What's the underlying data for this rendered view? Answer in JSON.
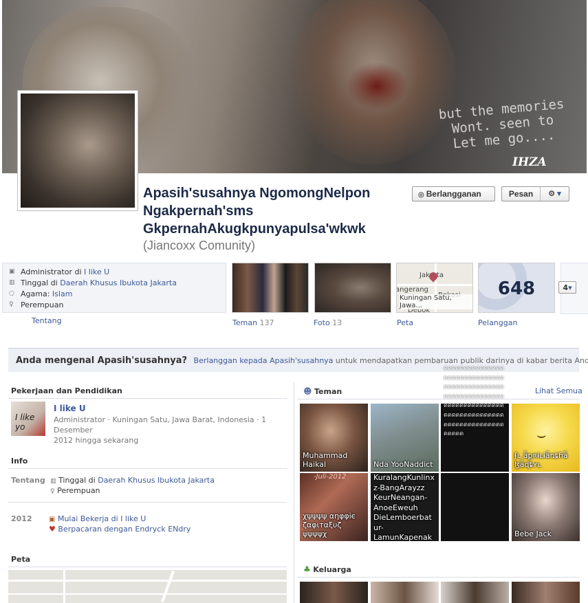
{
  "cover": {
    "quote_lines": [
      "but the memories",
      "Wont. seen to",
      "Let me go...."
    ],
    "signature": "IHZA"
  },
  "profile": {
    "name_lines": [
      "Apasih'susahnya NgomongNelpon",
      "Ngakpernah'sms",
      "GkpernahAkugkpunyapulsa'wkwk"
    ],
    "alternate_name": "(Jiancoxx Comunity)"
  },
  "actions": {
    "subscribe_label": "Berlangganan",
    "message_label": "Pesan"
  },
  "about": {
    "admin_prefix": "Administrator di ",
    "admin_link": "I like U",
    "lives_prefix": "Tinggal di ",
    "lives_link": "Daerah Khusus Ibukota Jakarta",
    "religion_prefix": "Agama: ",
    "religion_link": "Islam",
    "gender": "Perempuan",
    "tab_label": "Tentang"
  },
  "tiles": {
    "friends_label": "Teman",
    "friends_count": "137",
    "photos_label": "Foto",
    "photos_count": "13",
    "map_label": "Peta",
    "map_city_1": "Jakarta",
    "map_city_2": "Bekasi",
    "map_city_3": "angerang",
    "map_caption": "Kuningan Satu, Jawa...",
    "map_city_4": "Depok",
    "subscribers_count": "648",
    "subscribers_label": "Pelanggan",
    "more_count": "4"
  },
  "know_banner": {
    "question": "Anda mengenal Apasih'susahnya?",
    "link_text": "Berlanggan kepada Apasih'susahnya",
    "rest_text": " untuk mendapatkan pembaruan publik darinya di kabar berita Anda."
  },
  "work": {
    "heading": "Pekerjaan dan Pendidikan",
    "image_text": "I like yo",
    "title": "I like U",
    "detail_1": "Administrator · Kuningan Satu, Jawa Barat, Indonesia · 1 Desember",
    "detail_2": "2012 hingga sekarang"
  },
  "info": {
    "heading": "Info",
    "tentang_label": "Tentang",
    "lives_prefix": "Tinggal di ",
    "lives_link": "Daerah Khusus Ibukota Jakarta",
    "gender": "Perempuan",
    "year": "2012",
    "event_1_prefix": "Mulai Bekerja di ",
    "event_1_link": "I like U",
    "event_2": "Berpacaran dengan Endryck ENdry"
  },
  "map_section": {
    "heading": "Peta"
  },
  "friends_section": {
    "heading": "Teman",
    "see_all": "Lihat Semua",
    "friends": [
      "Muhammad Haikal",
      "Nda YooNaddict",
      "",
      "ʄʟ ǟքʀɨʟɨǟռȶɦǟ ɮǟɖȶʏʟ",
      "χψψψψ αηφφіє ζαφιтαξυζ ψψψψχ",
      "KuralangKunlinxz-BangArayzz KeurNeangan-AnoeEweuh DieLemboerbatur-LamunKapenak Arek'DiCang-Cang",
      "",
      "Bebe Jack"
    ],
    "photo_text": "-Juli-2012",
    "overlay_text": "ดดดดดดดดดดดดดดดดดดดดดดดดดดดดดดดดดดดดดดดดดดดดดดดดดดดดดดดดดดดดดดดดดดดดดดดดดดดดดดดดดดดดดดดดดดดดดดดดดดดดดดดดดดดดดด"
  },
  "family_section": {
    "heading": "Keluarga"
  }
}
